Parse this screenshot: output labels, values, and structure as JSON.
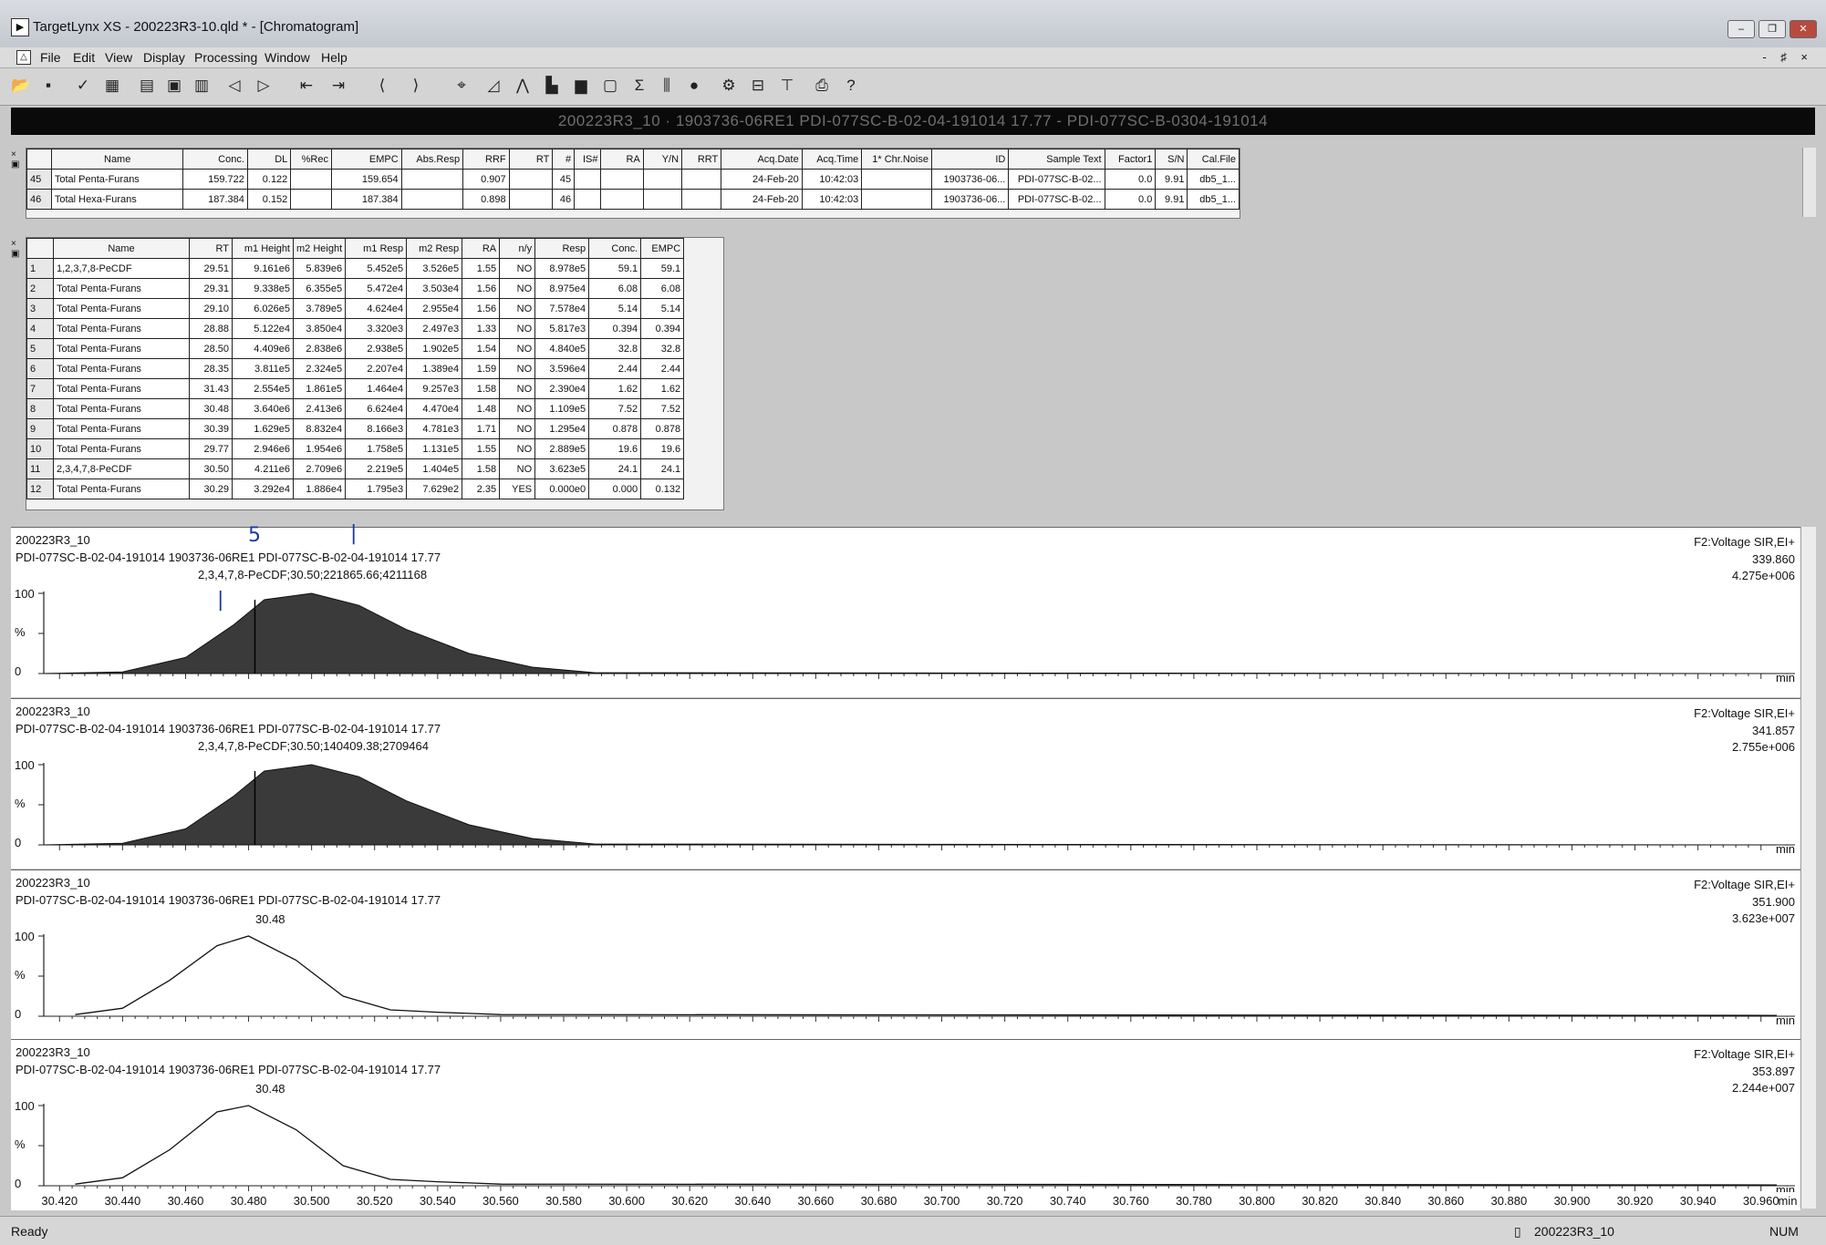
{
  "window": {
    "title": "TargetLynx XS - 200223R3-10.qld * - [Chromatogram]",
    "app_icon": "targetlynx-app-icon",
    "controls": [
      "minimize-icon",
      "restore-icon",
      "close-icon"
    ]
  },
  "menu": {
    "items": [
      "File",
      "Edit",
      "View",
      "Display",
      "Processing",
      "Window",
      "Help"
    ],
    "mdi_controls": "- ♯ ×"
  },
  "toolbar": {
    "icons": [
      "open-icon",
      "save-icon",
      "check-icon",
      "grid-icon",
      "list-view-icon",
      "report-icon",
      "print-preview-icon",
      "prev-sample-icon",
      "next-sample-icon",
      "prev-compound-icon",
      "next-compound-icon",
      "peak-left-icon",
      "peak-right-icon",
      "zoom-icon",
      "chart-icon",
      "chromatogram-icon",
      "spectrum-icon",
      "bar-icon",
      "window-icon",
      "sum-icon",
      "columns-icon",
      "circle-icon",
      "gear-icon",
      "split-horizontal-icon",
      "split-vertical-icon",
      "print-icon",
      "help-icon"
    ]
  },
  "sample_header": "200223R3_10 · 1903736-06RE1 PDI-077SC-B-02-04-191014 17.77 - PDI-077SC-B-0304-191014",
  "summary_table": {
    "headers": [
      "Name",
      "Conc.",
      "DL",
      "%Rec",
      "EMPC",
      "Abs.Resp",
      "RRF",
      "RT",
      "#",
      "IS#",
      "RA",
      "Y/N",
      "RRT",
      "Acq.Date",
      "Acq.Time",
      "1* Chr.Noise",
      "ID",
      "Sample Text",
      "Factor1",
      "S/N",
      "Cal.File"
    ],
    "rows": [
      {
        "n": "45",
        "cells": [
          "Total Penta-Furans",
          "159.722",
          "0.122",
          "",
          "159.654",
          "",
          "0.907",
          "",
          "45",
          "",
          "",
          "",
          "",
          "24-Feb-20",
          "10:42:03",
          "",
          "1903736-06...",
          "PDI-077SC-B-02...",
          "0.0",
          "9.91",
          "db5_1..."
        ]
      },
      {
        "n": "46",
        "cells": [
          "Total Hexa-Furans",
          "187.384",
          "0.152",
          "",
          "187.384",
          "",
          "0.898",
          "",
          "46",
          "",
          "",
          "",
          "",
          "24-Feb-20",
          "10:42:03",
          "",
          "1903736-06...",
          "PDI-077SC-B-02...",
          "0.0",
          "9.91",
          "db5_1..."
        ]
      }
    ]
  },
  "peak_table": {
    "headers": [
      "Name",
      "RT",
      "m1 Height",
      "m2 Height",
      "m1 Resp",
      "m2 Resp",
      "RA",
      "n/y",
      "Resp",
      "Conc.",
      "EMPC"
    ],
    "rows": [
      {
        "n": "1",
        "cells": [
          "1,2,3,7,8-PeCDF",
          "29.51",
          "9.161e6",
          "5.839e6",
          "5.452e5",
          "3.526e5",
          "1.55",
          "NO",
          "8.978e5",
          "59.1",
          "59.1"
        ]
      },
      {
        "n": "2",
        "cells": [
          "Total Penta-Furans",
          "29.31",
          "9.338e5",
          "6.355e5",
          "5.472e4",
          "3.503e4",
          "1.56",
          "NO",
          "8.975e4",
          "6.08",
          "6.08"
        ]
      },
      {
        "n": "3",
        "cells": [
          "Total Penta-Furans",
          "29.10",
          "6.026e5",
          "3.789e5",
          "4.624e4",
          "2.955e4",
          "1.56",
          "NO",
          "7.578e4",
          "5.14",
          "5.14"
        ]
      },
      {
        "n": "4",
        "cells": [
          "Total Penta-Furans",
          "28.88",
          "5.122e4",
          "3.850e4",
          "3.320e3",
          "2.497e3",
          "1.33",
          "NO",
          "5.817e3",
          "0.394",
          "0.394"
        ]
      },
      {
        "n": "5",
        "cells": [
          "Total Penta-Furans",
          "28.50",
          "4.409e6",
          "2.838e6",
          "2.938e5",
          "1.902e5",
          "1.54",
          "NO",
          "4.840e5",
          "32.8",
          "32.8"
        ]
      },
      {
        "n": "6",
        "cells": [
          "Total Penta-Furans",
          "28.35",
          "3.811e5",
          "2.324e5",
          "2.207e4",
          "1.389e4",
          "1.59",
          "NO",
          "3.596e4",
          "2.44",
          "2.44"
        ]
      },
      {
        "n": "7",
        "cells": [
          "Total Penta-Furans",
          "31.43",
          "2.554e5",
          "1.861e5",
          "1.464e4",
          "9.257e3",
          "1.58",
          "NO",
          "2.390e4",
          "1.62",
          "1.62"
        ]
      },
      {
        "n": "8",
        "cells": [
          "Total Penta-Furans",
          "30.48",
          "3.640e6",
          "2.413e6",
          "6.624e4",
          "4.470e4",
          "1.48",
          "NO",
          "1.109e5",
          "7.52",
          "7.52"
        ]
      },
      {
        "n": "9",
        "cells": [
          "Total Penta-Furans",
          "30.39",
          "1.629e5",
          "8.832e4",
          "8.166e3",
          "4.781e3",
          "1.71",
          "NO",
          "1.295e4",
          "0.878",
          "0.878"
        ]
      },
      {
        "n": "10",
        "cells": [
          "Total Penta-Furans",
          "29.77",
          "2.946e6",
          "1.954e6",
          "1.758e5",
          "1.131e5",
          "1.55",
          "NO",
          "2.889e5",
          "19.6",
          "19.6"
        ]
      },
      {
        "n": "11",
        "cells": [
          "2,3,4,7,8-PeCDF",
          "30.50",
          "4.211e6",
          "2.709e6",
          "2.219e5",
          "1.404e5",
          "1.58",
          "NO",
          "3.623e5",
          "24.1",
          "24.1"
        ]
      },
      {
        "n": "12",
        "cells": [
          "Total Penta-Furans",
          "30.29",
          "3.292e4",
          "1.886e4",
          "1.795e3",
          "7.629e2",
          "2.35",
          "YES",
          "0.000e0",
          "0.000",
          "0.132"
        ]
      }
    ]
  },
  "chromatograms": [
    {
      "batch": "200223R3_10",
      "sample": "PDI-077SC-B-02-04-191014 1903736-06RE1 PDI-077SC-B-02-04-191014 17.77",
      "peak_label": "2,3,4,7,8-PeCDF;30.50;221865.66;4211168",
      "function": "F2:Voltage SIR,EI+",
      "mass": "339.860",
      "intensity": "4.275e+006",
      "filled": true
    },
    {
      "batch": "200223R3_10",
      "sample": "PDI-077SC-B-02-04-191014 1903736-06RE1 PDI-077SC-B-02-04-191014 17.77",
      "peak_label": "2,3,4,7,8-PeCDF;30.50;140409.38;2709464",
      "function": "F2:Voltage SIR,EI+",
      "mass": "341.857",
      "intensity": "2.755e+006",
      "filled": true
    },
    {
      "batch": "200223R3_10",
      "sample": "PDI-077SC-B-02-04-191014 1903736-06RE1 PDI-077SC-B-02-04-191014 17.77",
      "peak_label": "30.48",
      "function": "F2:Voltage SIR,EI+",
      "mass": "351.900",
      "intensity": "3.623e+007",
      "filled": false
    },
    {
      "batch": "200223R3_10",
      "sample": "PDI-077SC-B-02-04-191014 1903736-06RE1 PDI-077SC-B-02-04-191014 17.77",
      "peak_label": "30.48",
      "function": "F2:Voltage SIR,EI+",
      "mass": "353.897",
      "intensity": "2.244e+007",
      "filled": false
    }
  ],
  "y_labels": {
    "top": "100",
    "mid": "%",
    "zero": "0"
  },
  "x_unit": "min",
  "x_ticks": [
    "30.420",
    "30.440",
    "30.460",
    "30.480",
    "30.500",
    "30.520",
    "30.540",
    "30.560",
    "30.580",
    "30.600",
    "30.620",
    "30.640",
    "30.660",
    "30.680",
    "30.700",
    "30.720",
    "30.740",
    "30.760",
    "30.780",
    "30.800",
    "30.820",
    "30.840",
    "30.860",
    "30.880",
    "30.900",
    "30.920",
    "30.940",
    "30.960"
  ],
  "annotations": [
    "5",
    "|",
    "|"
  ],
  "status": {
    "left": "Ready",
    "sample": "200223R3_10",
    "right": "NUM"
  },
  "colors": {
    "trace_fill": "#3a3a3a",
    "header_bar": "#0a0a0a",
    "ink": "#1b3aa8"
  }
}
